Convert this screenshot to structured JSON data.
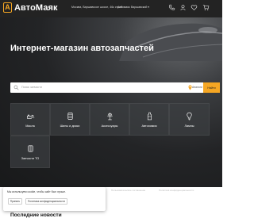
{
  "header": {
    "logo_letter": "A",
    "logo_text": "АвтоМаяк",
    "location": "Москва, Варшавское шоссе, 46к строй",
    "store": "Автомаяк Варшавский",
    "store_caret": "▾"
  },
  "hero": {
    "title": "Интернет-магазин автозапчастей"
  },
  "search": {
    "placeholder": "Поиск запчасти",
    "region": "Аналоги",
    "button_label": "Найти"
  },
  "categories": [
    {
      "label": "Масла",
      "icon": "oil-can-icon"
    },
    {
      "label": "Шины и диски",
      "icon": "tire-icon"
    },
    {
      "label": "Аксессуары",
      "icon": "accessory-icon"
    },
    {
      "label": "Автохимия",
      "icon": "bottle-icon"
    },
    {
      "label": "Лампы",
      "icon": "lamp-icon"
    },
    {
      "label": "Запчасти ТО",
      "icon": "filter-icon"
    }
  ],
  "cookie": {
    "text": "Мы используем cookie, чтобы сайт был лучше.",
    "accept_label": "Принять",
    "policy_label": "Политика конфиденциальности"
  },
  "footer_links": {
    "left": "Пользовательское соглашение",
    "right": "Политика конфиденциальности"
  },
  "news": {
    "title": "Последние новости"
  },
  "colors": {
    "accent": "#f5a623",
    "header_bg": "#232323"
  }
}
